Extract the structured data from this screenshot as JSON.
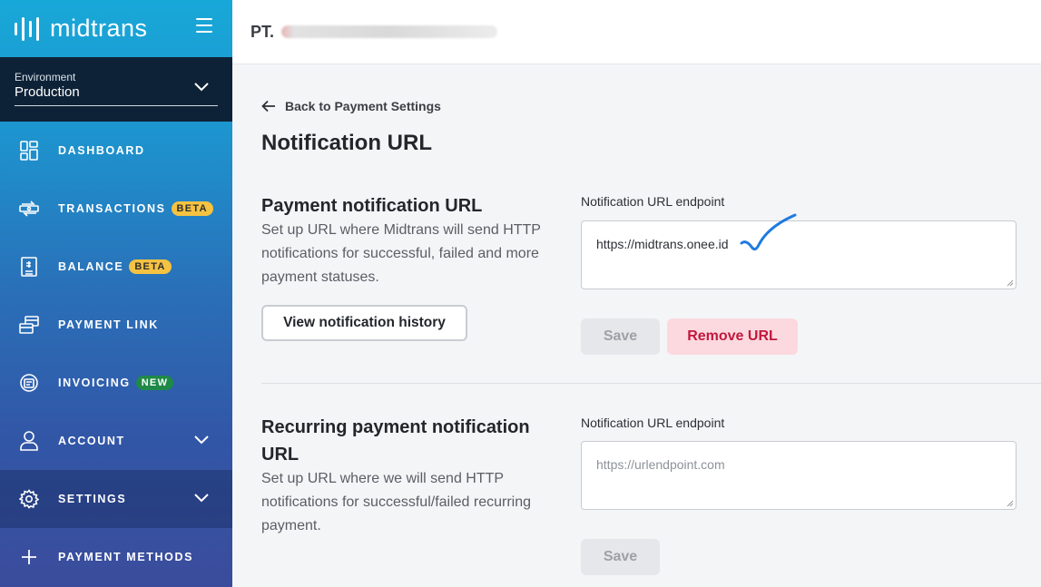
{
  "sidebar": {
    "brand": "midtrans",
    "environment_label": "Environment",
    "environment_value": "Production",
    "items": [
      {
        "label": "DASHBOARD"
      },
      {
        "label": "TRANSACTIONS",
        "badge": "BETA"
      },
      {
        "label": "BALANCE",
        "badge": "BETA"
      },
      {
        "label": "PAYMENT LINK"
      },
      {
        "label": "INVOICING",
        "badge": "NEW"
      },
      {
        "label": "ACCOUNT"
      },
      {
        "label": "SETTINGS"
      },
      {
        "label": "PAYMENT METHODS"
      }
    ]
  },
  "header": {
    "company_prefix": "PT."
  },
  "main": {
    "back_label": "Back to Payment Settings",
    "page_title": "Notification URL",
    "payment": {
      "title": "Payment notification URL",
      "description": "Set up URL where Midtrans will send HTTP notifications for successful, failed and more payment statuses.",
      "history_button": "View notification history",
      "field_label": "Notification URL endpoint",
      "field_value": "https://midtrans.onee.id",
      "save_label": "Save",
      "remove_label": "Remove URL"
    },
    "recurring": {
      "title": "Recurring payment notification URL",
      "description": "Set up URL where we will send HTTP notifications for successful/failed recurring payment.",
      "field_label": "Notification URL endpoint",
      "field_placeholder": "https://urlendpoint.com",
      "save_label": "Save"
    }
  },
  "colors": {
    "sidebar_top": "#18a8d8",
    "sidebar_bottom": "#3b4c9c",
    "remove_text": "#c2183d",
    "remove_bg": "#fcd9df",
    "annotation_check": "#1e7be0"
  }
}
